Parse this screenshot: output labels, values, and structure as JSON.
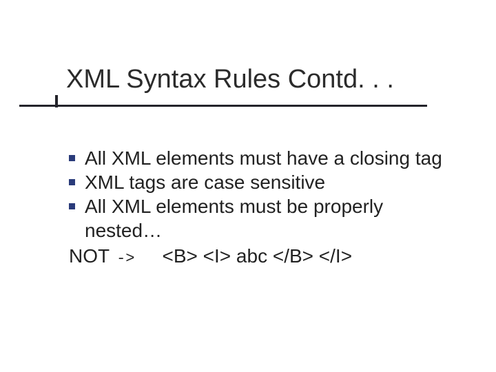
{
  "title": "XML Syntax Rules Contd. . .",
  "bullets": [
    "All XML elements must have a closing tag",
    "XML tags are case sensitive",
    "All XML elements must be properly nested…"
  ],
  "not_line": {
    "label": "NOT",
    "arrow": "->",
    "example": "<B> <I> abc </B> </I>"
  }
}
